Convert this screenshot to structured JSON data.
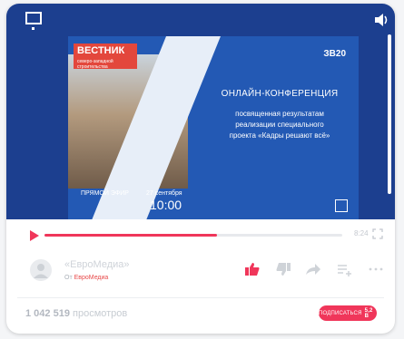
{
  "player": {
    "volume_fraction": 1.0,
    "thumbnail": {
      "logo_name": "ВЕСТНИК",
      "logo_tagline": "северо-западной строительства",
      "brand": "ЗВ20",
      "title": "ОНЛАЙН-КОНФЕРЕНЦИЯ",
      "text_lines": [
        "посвященная результатам",
        "реализации специального",
        "проекта «Кадры решают всё»"
      ],
      "live": "ПРЯМОЙ ЭФИР",
      "date": "27 сентября",
      "time": "10:00"
    }
  },
  "controls": {
    "progress_fraction": 0.58,
    "duration": "8:24"
  },
  "channel": {
    "name": "«ЕвроМедиа»",
    "from_prefix": "От",
    "from_name": "ЕвроМедиа"
  },
  "stats": {
    "views_number": "1 042 519",
    "views_label": "просмотров"
  },
  "subscribe": {
    "label": "ПОДПИСАТЬСЯ",
    "count": "5,2 В"
  },
  "colors": {
    "player_bg": "#1c3f8f",
    "accent": "#f0365a",
    "link": "#e84a4a"
  }
}
